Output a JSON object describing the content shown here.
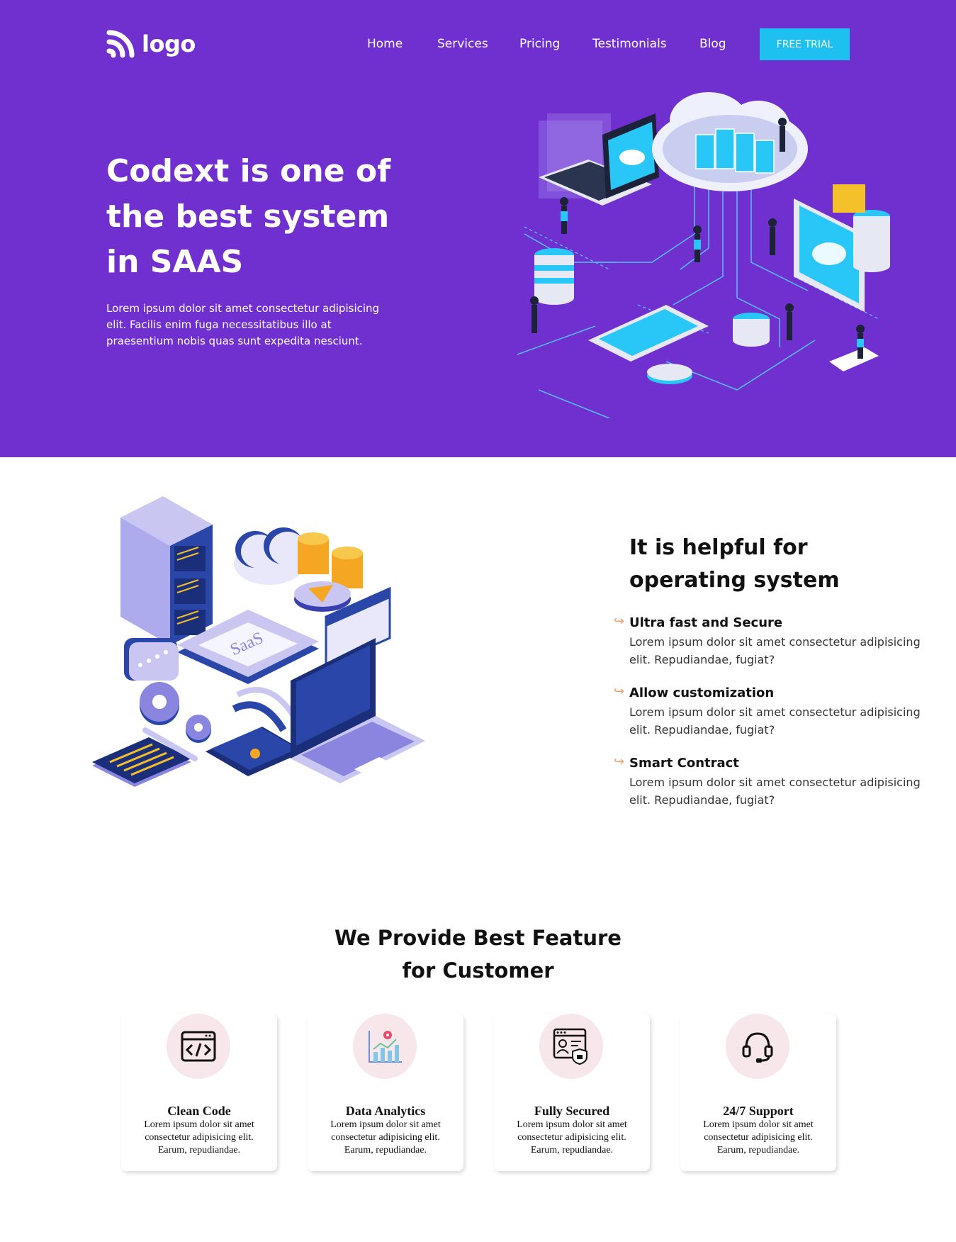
{
  "nav": {
    "logo_text": "logo",
    "links": [
      "Home",
      "Services",
      "Pricing",
      "Testimonials",
      "Blog"
    ],
    "cta": "FREE TRIAL"
  },
  "hero": {
    "title_lines": [
      "Codext is one of",
      "the best system",
      "in SAAS"
    ],
    "description": "Lorem ipsum dolor sit amet consectetur adipisicing elit. Facilis enim fuga necessitatibus illo at praesentium nobis quas sunt expedita nesciunt."
  },
  "about": {
    "title": "It is helpful for operating system",
    "features": [
      {
        "title": "Ultra fast and Secure",
        "text": "Lorem ipsum dolor sit amet consectetur adipisicing elit. Repudiandae, fugiat?"
      },
      {
        "title": "Allow customization",
        "text": "Lorem ipsum dolor sit amet consectetur adipisicing elit. Repudiandae, fugiat?"
      },
      {
        "title": "Smart Contract",
        "text": "Lorem ipsum dolor sit amet consectetur adipisicing elit. Repudiandae, fugiat?"
      }
    ],
    "illustration_label": "SaaS"
  },
  "features_section": {
    "title_lines": [
      "We Provide Best Feature",
      "for Customer"
    ],
    "cards": [
      {
        "title": "Clean Code",
        "text": "Lorem ipsum dolor sit amet consectetur adipisicing elit. Earum, repudiandae.",
        "icon": "code-window-icon"
      },
      {
        "title": "Data Analytics",
        "text": "Lorem ipsum dolor sit amet consectetur adipisicing elit. Earum, repudiandae.",
        "icon": "analytics-chart-icon"
      },
      {
        "title": "Fully Secured",
        "text": "Lorem ipsum dolor sit amet consectetur adipisicing elit. Earum, repudiandae.",
        "icon": "secure-profile-shield-icon"
      },
      {
        "title": "24/7 Support",
        "text": "Lorem ipsum dolor sit amet consectetur adipisicing elit. Earum, repudiandae.",
        "icon": "headset-icon"
      }
    ]
  },
  "colors": {
    "hero_bg": "#7030d0",
    "cta_bg": "#1ec0f0",
    "accent_arrow": "#f0a070",
    "icon_circle": "#f7e6ea"
  }
}
